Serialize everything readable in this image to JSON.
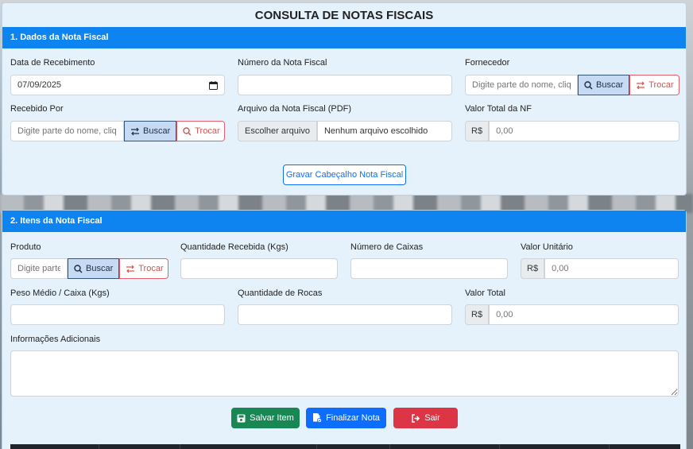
{
  "page_title": "CONSULTA DE NOTAS FISCAIS",
  "section1": {
    "header": "1. Dados da Nota Fiscal",
    "data_recebimento": {
      "label": "Data de Recebimento",
      "value": "07/09/2025"
    },
    "numero_nota": {
      "label": "Número da Nota Fiscal",
      "value": ""
    },
    "fornecedor": {
      "label": "Fornecedor",
      "placeholder": "Digite parte do nome, cliq",
      "buscar": "Buscar",
      "trocar": "Trocar"
    },
    "recebido_por": {
      "label": "Recebido Por",
      "placeholder": "Digite parte do nome, cliq",
      "buscar": "Buscar",
      "trocar": "Trocar"
    },
    "arquivo_pdf": {
      "label": "Arquivo da Nota Fiscal (PDF)",
      "choose": "Escolher arquivo",
      "filename": "Nenhum arquivo escolhido"
    },
    "valor_total_nf": {
      "label": "Valor Total da NF",
      "currency": "R$",
      "placeholder": "0,00"
    },
    "save_header_button": "Gravar Cabeçalho Nota Fiscal"
  },
  "section2": {
    "header": "2. Itens da Nota Fiscal",
    "produto": {
      "label": "Produto",
      "placeholder": "Digite parte",
      "buscar": "Buscar",
      "trocar": "Trocar"
    },
    "quantidade_recebida": {
      "label": "Quantidade Recebida (Kgs)",
      "value": ""
    },
    "numero_caixas": {
      "label": "Número de Caixas",
      "value": ""
    },
    "valor_unitario": {
      "label": "Valor Unitário",
      "currency": "R$",
      "placeholder": "0,00"
    },
    "peso_medio": {
      "label": "Peso Médio / Caixa (Kgs)",
      "value": ""
    },
    "quantidade_rocas": {
      "label": "Quantidade de Rocas",
      "value": ""
    },
    "valor_total": {
      "label": "Valor Total",
      "currency": "R$",
      "placeholder": "0,00"
    },
    "info_adicionais": {
      "label": "Informações Adicionais",
      "value": ""
    },
    "buttons": {
      "salvar": "Salvar Item",
      "finalizar": "Finalizar Nota",
      "sair": "Sair"
    }
  },
  "colors": {
    "section_header": "#0d84f0",
    "card_bg": "#e5f1fb",
    "success": "#198754",
    "primary": "#0d6efd",
    "danger": "#dc3545"
  }
}
